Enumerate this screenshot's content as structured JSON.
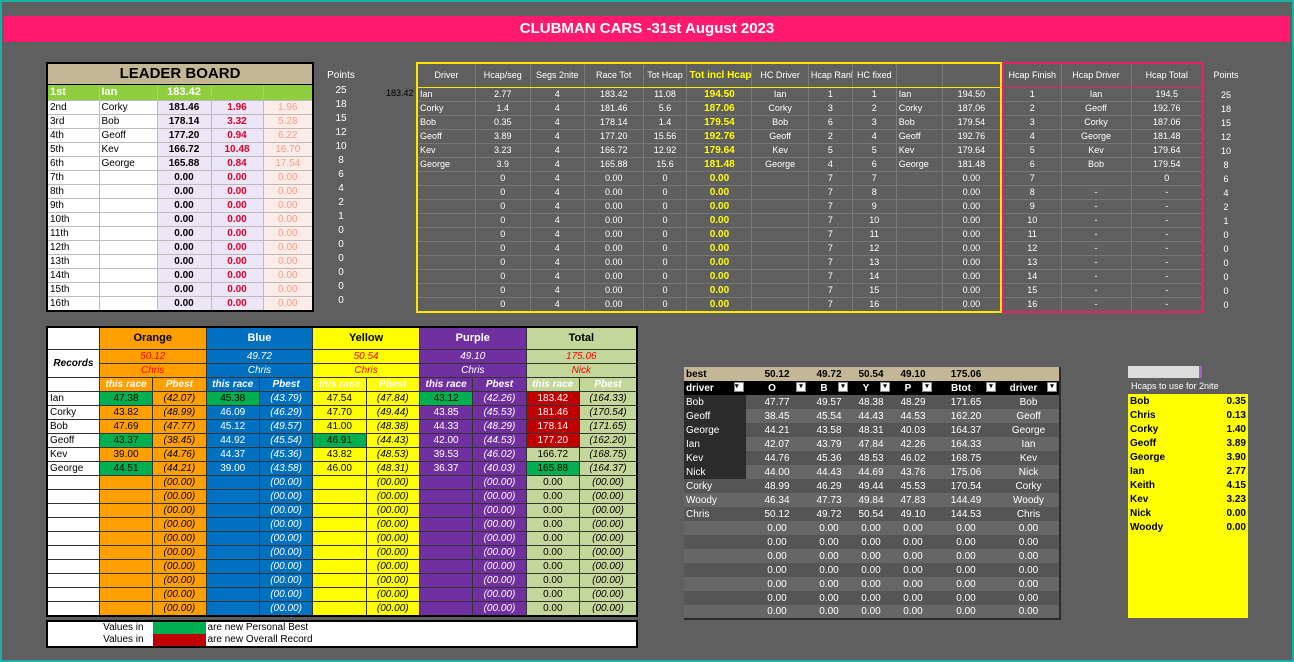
{
  "title": "CLUBMAN CARS -31st August 2023",
  "stray_value": "183.42",
  "leaderboard": {
    "title": "LEADER BOARD",
    "rows": [
      [
        "1st",
        "Ian",
        "183.42",
        "",
        ""
      ],
      [
        "2nd",
        "Corky",
        "181.46",
        "1.96",
        "1.96"
      ],
      [
        "3rd",
        "Bob",
        "178.14",
        "3.32",
        "5.28"
      ],
      [
        "4th",
        "Geoff",
        "177.20",
        "0.94",
        "6.22"
      ],
      [
        "5th",
        "Kev",
        "166.72",
        "10.48",
        "16.70"
      ],
      [
        "6th",
        "George",
        "165.88",
        "0.84",
        "17.54"
      ],
      [
        "7th",
        "",
        "0.00",
        "0.00",
        "0.00"
      ],
      [
        "8th",
        "",
        "0.00",
        "0.00",
        "0.00"
      ],
      [
        "9th",
        "",
        "0.00",
        "0.00",
        "0.00"
      ],
      [
        "10th",
        "",
        "0.00",
        "0.00",
        "0.00"
      ],
      [
        "11th",
        "",
        "0.00",
        "0.00",
        "0.00"
      ],
      [
        "12th",
        "",
        "0.00",
        "0.00",
        "0.00"
      ],
      [
        "13th",
        "",
        "0.00",
        "0.00",
        "0.00"
      ],
      [
        "14th",
        "",
        "0.00",
        "0.00",
        "0.00"
      ],
      [
        "15th",
        "",
        "0.00",
        "0.00",
        "0.00"
      ],
      [
        "16th",
        "",
        "0.00",
        "0.00",
        "0.00"
      ]
    ]
  },
  "points_left": {
    "header": "Points",
    "values": [
      "25",
      "18",
      "15",
      "12",
      "10",
      "8",
      "6",
      "4",
      "2",
      "1",
      "0",
      "0",
      "0",
      "0",
      "0",
      "0"
    ]
  },
  "hcap_table": {
    "headers": [
      "Driver",
      "Hcap/seg",
      "Segs 2nite",
      "Race Tot",
      "Tot Hcap",
      "Tot incl Hcap",
      "HC Driver",
      "Hcap Rank",
      "HC fixed",
      "",
      ""
    ],
    "rows": [
      [
        "Ian",
        "2.77",
        "4",
        "183.42",
        "11.08",
        "194.50",
        "Ian",
        "1",
        "1",
        "Ian",
        "194.50"
      ],
      [
        "Corky",
        "1.4",
        "4",
        "181.46",
        "5.6",
        "187.06",
        "Corky",
        "3",
        "2",
        "Corky",
        "187.06"
      ],
      [
        "Bob",
        "0.35",
        "4",
        "178.14",
        "1.4",
        "179.54",
        "Bob",
        "6",
        "3",
        "Bob",
        "179.54"
      ],
      [
        "Geoff",
        "3.89",
        "4",
        "177.20",
        "15.56",
        "192.76",
        "Geoff",
        "2",
        "4",
        "Geoff",
        "192.76"
      ],
      [
        "Kev",
        "3.23",
        "4",
        "166.72",
        "12.92",
        "179.64",
        "Kev",
        "5",
        "5",
        "Kev",
        "179.64"
      ],
      [
        "George",
        "3.9",
        "4",
        "165.88",
        "15.6",
        "181.48",
        "George",
        "4",
        "6",
        "George",
        "181.48"
      ],
      [
        "",
        "0",
        "4",
        "0.00",
        "0",
        "0.00",
        "",
        "7",
        "7",
        "",
        "0.00"
      ],
      [
        "",
        "0",
        "4",
        "0.00",
        "0",
        "0.00",
        "",
        "7",
        "8",
        "",
        "0.00"
      ],
      [
        "",
        "0",
        "4",
        "0.00",
        "0",
        "0.00",
        "",
        "7",
        "9",
        "",
        "0.00"
      ],
      [
        "",
        "0",
        "4",
        "0.00",
        "0",
        "0.00",
        "",
        "7",
        "10",
        "",
        "0.00"
      ],
      [
        "",
        "0",
        "4",
        "0.00",
        "0",
        "0.00",
        "",
        "7",
        "11",
        "",
        "0.00"
      ],
      [
        "",
        "0",
        "4",
        "0.00",
        "0",
        "0.00",
        "",
        "7",
        "12",
        "",
        "0.00"
      ],
      [
        "",
        "0",
        "4",
        "0.00",
        "0",
        "0.00",
        "",
        "7",
        "13",
        "",
        "0.00"
      ],
      [
        "",
        "0",
        "4",
        "0.00",
        "0",
        "0.00",
        "",
        "7",
        "14",
        "",
        "0.00"
      ],
      [
        "",
        "0",
        "4",
        "0.00",
        "0",
        "0.00",
        "",
        "7",
        "15",
        "",
        "0.00"
      ],
      [
        "",
        "0",
        "4",
        "0.00",
        "0",
        "0.00",
        "",
        "7",
        "16",
        "",
        "0.00"
      ]
    ]
  },
  "hcap_results": {
    "headers": [
      "Hcap Finish",
      "Hcap Driver",
      "Hcap Total"
    ],
    "rows": [
      [
        "1",
        "Ian",
        "194.5"
      ],
      [
        "2",
        "Geoff",
        "192.76"
      ],
      [
        "3",
        "Corky",
        "187.06"
      ],
      [
        "4",
        "George",
        "181.48"
      ],
      [
        "5",
        "Kev",
        "179.64"
      ],
      [
        "6",
        "Bob",
        "179.54"
      ],
      [
        "7",
        "",
        "0"
      ],
      [
        "8",
        "-",
        "-"
      ],
      [
        "9",
        "-",
        "-"
      ],
      [
        "10",
        "-",
        "-"
      ],
      [
        "11",
        "-",
        "-"
      ],
      [
        "12",
        "-",
        "-"
      ],
      [
        "13",
        "-",
        "-"
      ],
      [
        "14",
        "-",
        "-"
      ],
      [
        "15",
        "-",
        "-"
      ],
      [
        "16",
        "-",
        "-"
      ]
    ]
  },
  "points_right": {
    "header": "Points",
    "values": [
      "25",
      "18",
      "15",
      "12",
      "10",
      "8",
      "6",
      "4",
      "2",
      "1",
      "0",
      "0",
      "0",
      "0",
      "0",
      "0"
    ]
  },
  "records": {
    "colours": [
      "Orange",
      "Blue",
      "Yellow",
      "Purple",
      "Total"
    ],
    "label": "Records",
    "record_values": [
      "50.12",
      "49.72",
      "50.54",
      "49.10",
      "175.06"
    ],
    "record_holders": [
      "Chris",
      "Chris",
      "Chris",
      "Chris",
      "Nick"
    ],
    "subheaders": [
      "this race",
      "Pbest"
    ],
    "rows": [
      [
        "Ian",
        "47.38",
        "(42.07)",
        "45.38",
        "(43.79)",
        "47.54",
        "(47.84)",
        "43.12",
        "(42.26)",
        "183.42",
        "(164.33)"
      ],
      [
        "Corky",
        "43.82",
        "(48.99)",
        "46.09",
        "(46.29)",
        "47.70",
        "(49.44)",
        "43.85",
        "(45.53)",
        "181.46",
        "(170.54)"
      ],
      [
        "Bob",
        "47.69",
        "(47.77)",
        "45.12",
        "(49.57)",
        "41.00",
        "(48.38)",
        "44.33",
        "(48.29)",
        "178.14",
        "(171.65)"
      ],
      [
        "Geoff",
        "43.37",
        "(38.45)",
        "44.92",
        "(45.54)",
        "46.91",
        "(44.43)",
        "42.00",
        "(44.53)",
        "177.20",
        "(162.20)"
      ],
      [
        "Kev",
        "39.00",
        "(44.76)",
        "44.37",
        "(45.36)",
        "43.82",
        "(48.53)",
        "39.53",
        "(46.02)",
        "166.72",
        "(168.75)"
      ],
      [
        "George",
        "44.51",
        "(44.21)",
        "39.00",
        "(43.58)",
        "46.00",
        "(48.31)",
        "36.37",
        "(40.03)",
        "165.88",
        "(164.37)"
      ],
      [
        "",
        "",
        "(00.00)",
        "",
        "(00.00)",
        "",
        "(00.00)",
        "",
        "(00.00)",
        "0.00",
        "(00.00)"
      ],
      [
        "",
        "",
        "(00.00)",
        "",
        "(00.00)",
        "",
        "(00.00)",
        "",
        "(00.00)",
        "0.00",
        "(00.00)"
      ],
      [
        "",
        "",
        "(00.00)",
        "",
        "(00.00)",
        "",
        "(00.00)",
        "",
        "(00.00)",
        "0.00",
        "(00.00)"
      ],
      [
        "",
        "",
        "(00.00)",
        "",
        "(00.00)",
        "",
        "(00.00)",
        "",
        "(00.00)",
        "0.00",
        "(00.00)"
      ],
      [
        "",
        "",
        "(00.00)",
        "",
        "(00.00)",
        "",
        "(00.00)",
        "",
        "(00.00)",
        "0.00",
        "(00.00)"
      ],
      [
        "",
        "",
        "(00.00)",
        "",
        "(00.00)",
        "",
        "(00.00)",
        "",
        "(00.00)",
        "0.00",
        "(00.00)"
      ],
      [
        "",
        "",
        "(00.00)",
        "",
        "(00.00)",
        "",
        "(00.00)",
        "",
        "(00.00)",
        "0.00",
        "(00.00)"
      ],
      [
        "",
        "",
        "(00.00)",
        "",
        "(00.00)",
        "",
        "(00.00)",
        "",
        "(00.00)",
        "0.00",
        "(00.00)"
      ],
      [
        "",
        "",
        "(00.00)",
        "",
        "(00.00)",
        "",
        "(00.00)",
        "",
        "(00.00)",
        "0.00",
        "(00.00)"
      ],
      [
        "",
        "",
        "(00.00)",
        "",
        "(00.00)",
        "",
        "(00.00)",
        "",
        "(00.00)",
        "0.00",
        "(00.00)"
      ]
    ],
    "highlights": {
      "green": [
        [
          0,
          1
        ],
        [
          0,
          3
        ],
        [
          0,
          7
        ],
        [
          3,
          1
        ],
        [
          3,
          5
        ],
        [
          5,
          1
        ],
        [
          5,
          9
        ]
      ],
      "red": [
        [
          0,
          9
        ],
        [
          1,
          9
        ],
        [
          2,
          9
        ],
        [
          3,
          9
        ]
      ]
    }
  },
  "legend": [
    {
      "prefix": "Values in",
      "text": "are new Personal Best"
    },
    {
      "prefix": "Values in",
      "text": "are new Overall Record"
    }
  ],
  "best_times": {
    "best_row": [
      "best",
      "50.12",
      "49.72",
      "50.54",
      "49.10",
      "175.06",
      ""
    ],
    "headers": [
      "driver",
      "O",
      "B",
      "Y",
      "P",
      "Btot",
      "driver"
    ],
    "rows": [
      [
        "Bob",
        "47.77",
        "49.57",
        "48.38",
        "48.29",
        "171.65",
        "Bob"
      ],
      [
        "Geoff",
        "38.45",
        "45.54",
        "44.43",
        "44.53",
        "162.20",
        "Geoff"
      ],
      [
        "George",
        "44.21",
        "43.58",
        "48.31",
        "40.03",
        "164.37",
        "George"
      ],
      [
        "Ian",
        "42.07",
        "43.79",
        "47.84",
        "42.26",
        "164.33",
        "Ian"
      ],
      [
        "Kev",
        "44.76",
        "45.36",
        "48.53",
        "46.02",
        "168.75",
        "Kev"
      ],
      [
        "Nick",
        "44.00",
        "44.43",
        "44.69",
        "43.76",
        "175.06",
        "Nick"
      ],
      [
        "Corky",
        "48.99",
        "46.29",
        "49.44",
        "45.53",
        "170.54",
        "Corky"
      ],
      [
        "Woody",
        "46.34",
        "47.73",
        "49.84",
        "47.83",
        "144.49",
        "Woody"
      ],
      [
        "Chris",
        "50.12",
        "49.72",
        "50.54",
        "49.10",
        "144.53",
        "Chris"
      ],
      [
        "",
        "0.00",
        "0.00",
        "0.00",
        "0.00",
        "0.00",
        "0.00"
      ],
      [
        "",
        "0.00",
        "0.00",
        "0.00",
        "0.00",
        "0.00",
        "0.00"
      ],
      [
        "",
        "0.00",
        "0.00",
        "0.00",
        "0.00",
        "0.00",
        "0.00"
      ],
      [
        "",
        "0.00",
        "0.00",
        "0.00",
        "0.00",
        "0.00",
        "0.00"
      ],
      [
        "",
        "0.00",
        "0.00",
        "0.00",
        "0.00",
        "0.00",
        "0.00"
      ],
      [
        "",
        "0.00",
        "0.00",
        "0.00",
        "0.00",
        "0.00",
        "0.00"
      ],
      [
        "",
        "0.00",
        "0.00",
        "0.00",
        "0.00",
        "0.00",
        "0.00"
      ]
    ]
  },
  "hcaps_2nite": {
    "title": "Hcaps to use for 2nite",
    "rows": [
      [
        "Bob",
        "0.35"
      ],
      [
        "Chris",
        "0.13"
      ],
      [
        "Corky",
        "1.40"
      ],
      [
        "Geoff",
        "3.89"
      ],
      [
        "George",
        "3.90"
      ],
      [
        "Ian",
        "2.77"
      ],
      [
        "Keith",
        "4.15"
      ],
      [
        "Kev",
        "3.23"
      ],
      [
        "Nick",
        "0.00"
      ],
      [
        "Woody",
        "0.00"
      ]
    ]
  }
}
